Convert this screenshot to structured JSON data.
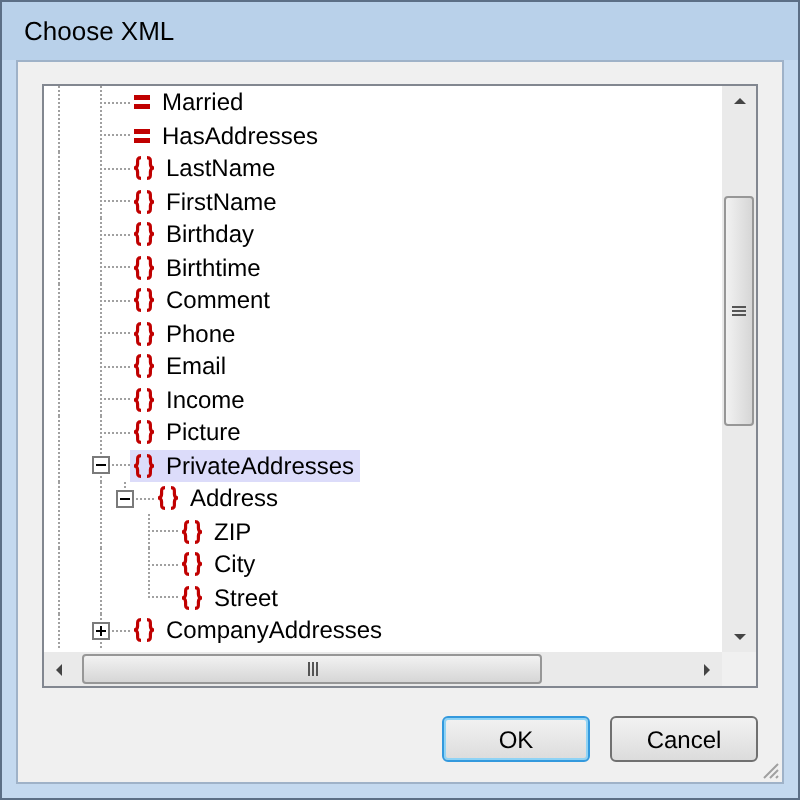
{
  "window": {
    "title": "Choose XML"
  },
  "tree": [
    {
      "label": "Married",
      "kind": "attribute",
      "selected": false
    },
    {
      "label": "HasAddresses",
      "kind": "attribute",
      "selected": false
    },
    {
      "label": "LastName",
      "kind": "element",
      "selected": false
    },
    {
      "label": "FirstName",
      "kind": "element",
      "selected": false
    },
    {
      "label": "Birthday",
      "kind": "element",
      "selected": false
    },
    {
      "label": "Birthtime",
      "kind": "element",
      "selected": false
    },
    {
      "label": "Comment",
      "kind": "element",
      "selected": false
    },
    {
      "label": "Phone",
      "kind": "element",
      "selected": false
    },
    {
      "label": "Email",
      "kind": "element",
      "selected": false
    },
    {
      "label": "Income",
      "kind": "element",
      "selected": false
    },
    {
      "label": "Picture",
      "kind": "element",
      "selected": false
    },
    {
      "label": "PrivateAddresses",
      "kind": "element",
      "selected": true,
      "expanded": true,
      "children": [
        {
          "label": "Address",
          "kind": "element",
          "selected": false,
          "expanded": true,
          "children": [
            {
              "label": "ZIP",
              "kind": "element",
              "selected": false
            },
            {
              "label": "City",
              "kind": "element",
              "selected": false
            },
            {
              "label": "Street",
              "kind": "element",
              "selected": false
            }
          ]
        }
      ]
    },
    {
      "label": "CompanyAddresses",
      "kind": "element",
      "selected": false,
      "expanded": false
    }
  ],
  "buttons": [
    {
      "label": "OK",
      "default": true
    },
    {
      "label": "Cancel",
      "default": false
    }
  ]
}
